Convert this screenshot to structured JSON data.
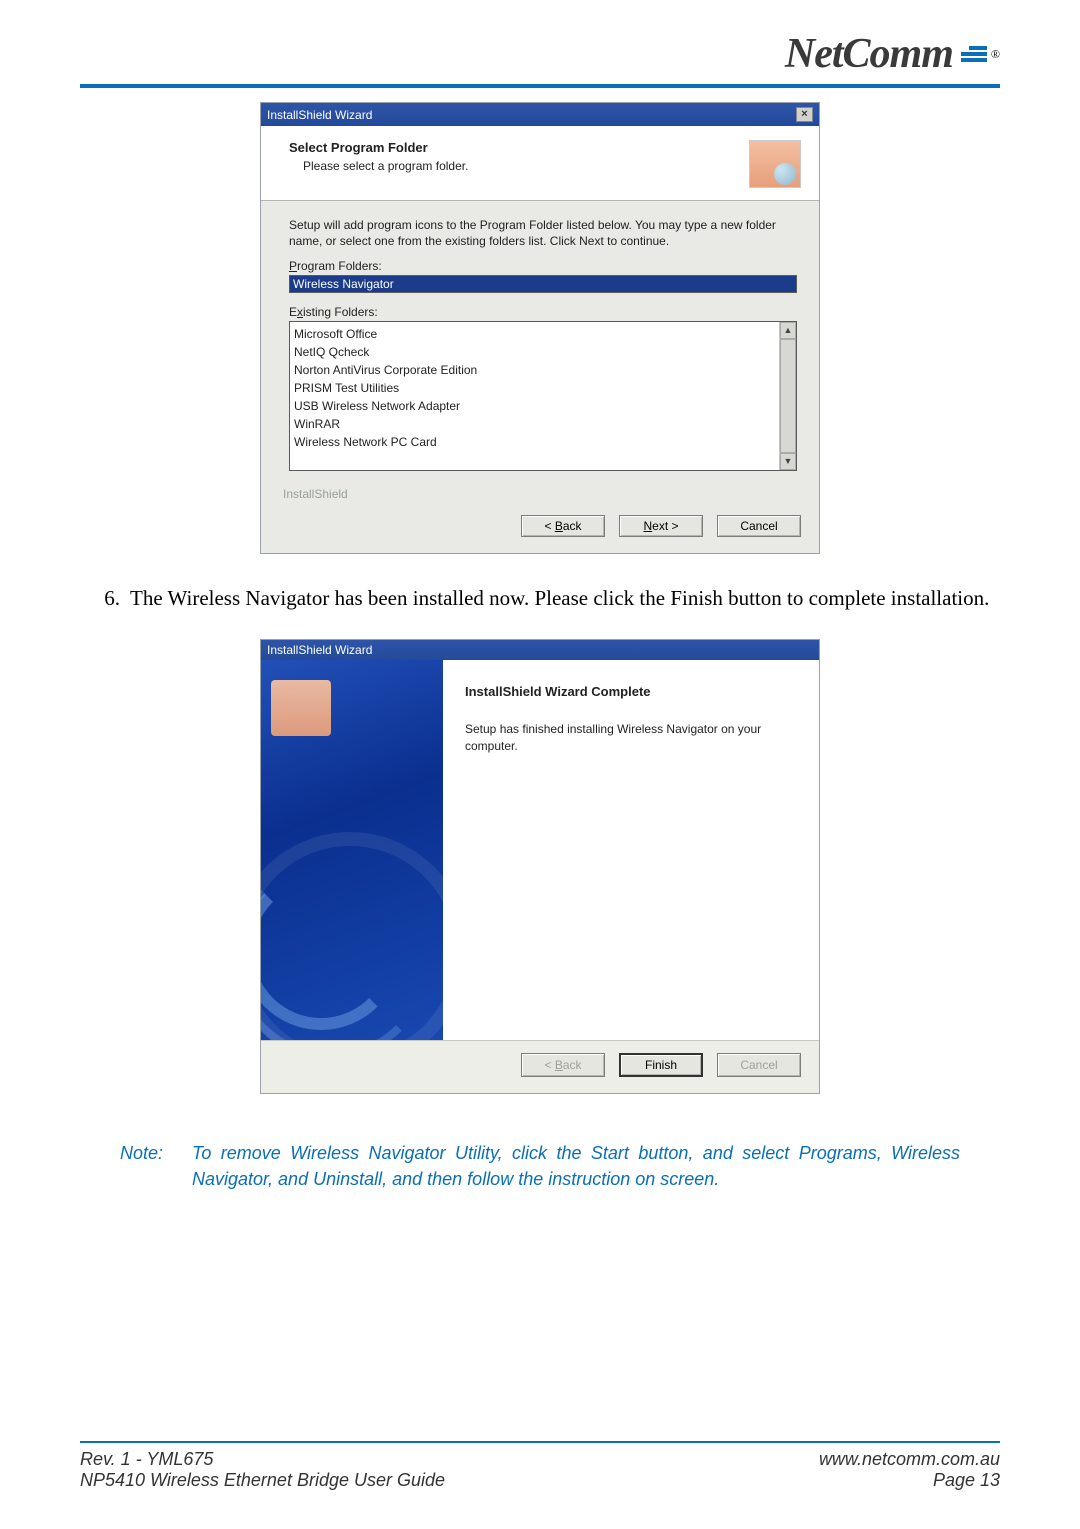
{
  "logo": {
    "brand": "NetComm",
    "reg": "®"
  },
  "dialog1": {
    "title": "InstallShield Wizard",
    "header_title": "Select Program Folder",
    "header_sub": "Please select a program folder.",
    "body_text": "Setup will add program icons to the Program Folder listed below.  You may type a new folder name, or select one from the existing folders list.  Click Next to continue.",
    "program_folders_label": "Program Folders:",
    "program_folders_value": "Wireless Navigator",
    "existing_folders_label": "Existing Folders:",
    "existing_folders": [
      "Microsoft Office",
      "NetIQ Qcheck",
      "Norton AntiVirus Corporate Edition",
      "PRISM Test Utilities",
      "USB Wireless Network Adapter",
      "WinRAR",
      "Wireless Network PC Card"
    ],
    "brand_label": "InstallShield",
    "buttons": {
      "back": "< Back",
      "next": "Next >",
      "cancel": "Cancel"
    }
  },
  "step6": {
    "num": "6.",
    "text": "The Wireless Navigator has been installed now. Please click the Finish button to complete installation."
  },
  "dialog2": {
    "title": "InstallShield Wizard",
    "heading": "InstallShield Wizard Complete",
    "body": "Setup has finished installing Wireless Navigator on your computer.",
    "buttons": {
      "back": "< Back",
      "finish": "Finish",
      "cancel": "Cancel"
    }
  },
  "note": {
    "label": "Note:",
    "text": "To remove Wireless Navigator Utility, click the Start button, and select Programs, Wireless Navigator, and Uninstall, and then follow the instruction on screen."
  },
  "footer": {
    "rev": "Rev. 1 - YML675",
    "url": "www.netcomm.com.au",
    "guide": "NP5410 Wireless Ethernet Bridge User Guide",
    "page": "Page 13"
  }
}
